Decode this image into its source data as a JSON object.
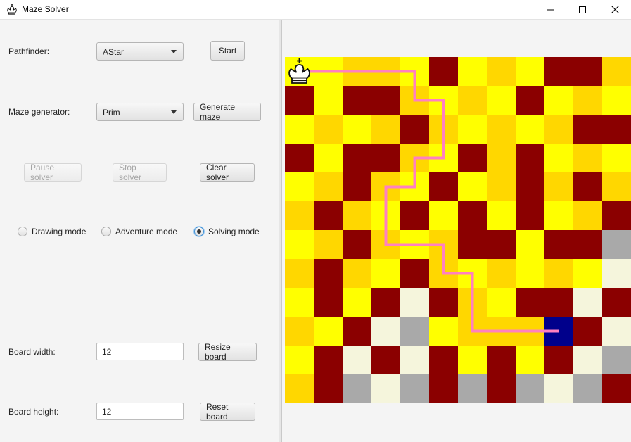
{
  "window": {
    "title": "Maze Solver",
    "icon": "chess-king-icon",
    "controls": [
      "minimize-icon",
      "maximize-icon",
      "close-icon"
    ]
  },
  "controls": {
    "pathfinder_label": "Pathfinder:",
    "pathfinder_value": "AStar",
    "start_label": "Start",
    "maze_generator_label": "Maze generator:",
    "maze_generator_value": "Prim",
    "generate_maze_label": "Generate maze",
    "pause_solver_label": "Pause solver",
    "stop_solver_label": "Stop solver",
    "clear_solver_label": "Clear solver",
    "modes": [
      {
        "label": "Drawing mode",
        "selected": false
      },
      {
        "label": "Adventure mode",
        "selected": false
      },
      {
        "label": "Solving mode",
        "selected": true
      }
    ],
    "board_width_label": "Board width:",
    "board_width_value": "12",
    "resize_board_label": "Resize board",
    "board_height_label": "Board height:",
    "board_height_value": "12",
    "reset_board_label": "Reset board"
  },
  "board": {
    "colors": {
      "Y": "#ffff00",
      "G": "#ffd700",
      "R": "#8b0000",
      "C": "#f5f5dc",
      "S": "#a9a9a9",
      "B": "#00008b"
    },
    "path_color": "#ff80c0",
    "rows": [
      "YYGGYRYGYRRG",
      "RYRRGYGYRYGY",
      "YGYGRGYGYGRR",
      "RYRRGYRGRYGY",
      "YGRGYRYGRGRG",
      "GRGYRYRYRYGR",
      "YGRGYGRRYRRS",
      "GRGYRGYGYGYC",
      "YRYRCRGYRRCR",
      "GYRCSYGGGBRC",
      "YRCRCRYRYRCS",
      "GRSCSRSRSCSR"
    ],
    "path": [
      [
        0,
        0
      ],
      [
        0,
        1
      ],
      [
        0,
        2
      ],
      [
        0,
        3
      ],
      [
        0,
        4
      ],
      [
        1,
        4
      ],
      [
        1,
        5
      ],
      [
        2,
        5
      ],
      [
        3,
        5
      ],
      [
        3,
        4
      ],
      [
        4,
        4
      ],
      [
        4,
        3
      ],
      [
        5,
        3
      ],
      [
        6,
        3
      ],
      [
        6,
        4
      ],
      [
        6,
        5
      ],
      [
        7,
        5
      ],
      [
        7,
        6
      ],
      [
        8,
        6
      ],
      [
        9,
        6
      ],
      [
        9,
        7
      ],
      [
        9,
        8
      ],
      [
        9,
        9
      ]
    ],
    "start": [
      0,
      0
    ],
    "goal": [
      9,
      9
    ],
    "start_piece": "chess-king-icon"
  }
}
